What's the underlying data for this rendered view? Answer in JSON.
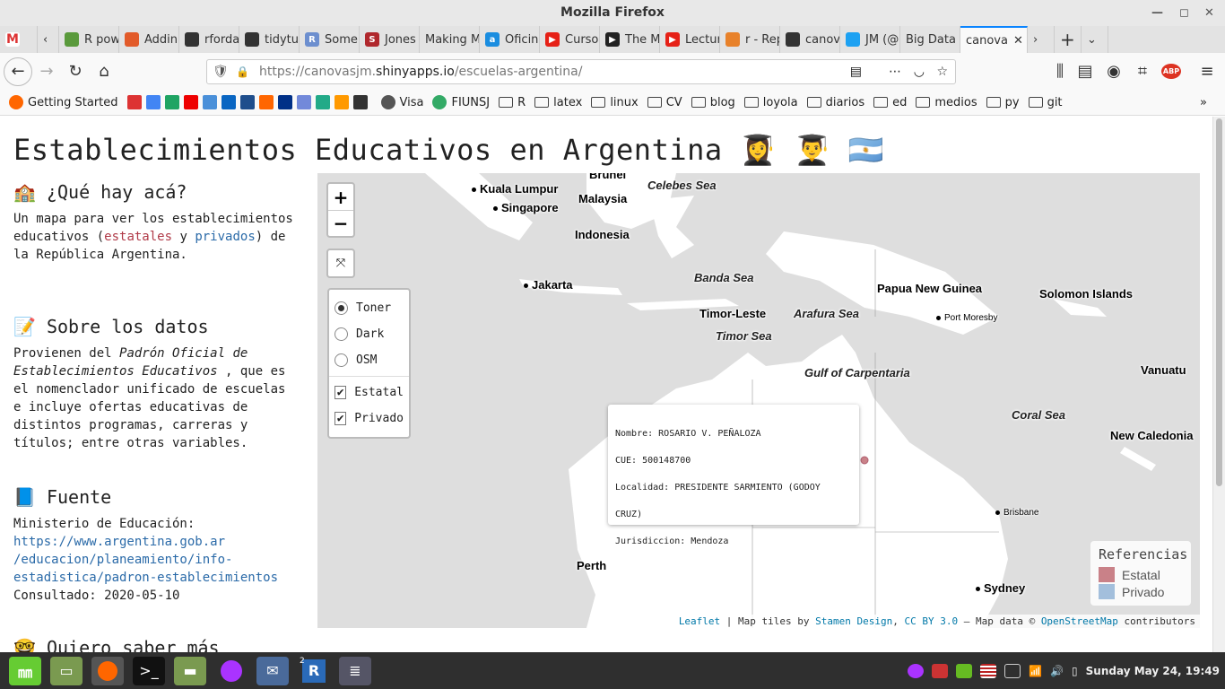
{
  "window": {
    "title": "Mozilla Firefox"
  },
  "tabs": [
    {
      "label": "",
      "color": "#d93025",
      "icon": "M"
    },
    {
      "label": "R pow",
      "color": "#5a9a3c",
      "icon": ""
    },
    {
      "label": "Addin",
      "color": "#e25b2a",
      "icon": ""
    },
    {
      "label": "rforda",
      "color": "#333333",
      "icon": ""
    },
    {
      "label": "tidytu",
      "color": "#333333",
      "icon": ""
    },
    {
      "label": "Some",
      "color": "#6d8fcf",
      "icon": "R"
    },
    {
      "label": "Jones",
      "color": "#b0282d",
      "icon": "S"
    },
    {
      "label": "Making M",
      "color": "",
      "icon": ""
    },
    {
      "label": "Oficin",
      "color": "#1a8de0",
      "icon": "a"
    },
    {
      "label": "Curso",
      "color": "#e62117",
      "icon": "▶"
    },
    {
      "label": "The M",
      "color": "#222222",
      "icon": "▶"
    },
    {
      "label": "Lectur",
      "color": "#e62117",
      "icon": "▶"
    },
    {
      "label": "r - Rep",
      "color": "#e8822b",
      "icon": ""
    },
    {
      "label": "canov",
      "color": "#333333",
      "icon": ""
    },
    {
      "label": "JM (@",
      "color": "#1da1f2",
      "icon": ""
    },
    {
      "label": "Big Data i",
      "color": "",
      "icon": ""
    },
    {
      "label": "canova",
      "color": "",
      "icon": "",
      "active": true
    }
  ],
  "url": {
    "prefix": "https://canovasjm.",
    "host": "shinyapps.io",
    "path": "/escuelas-argentina/"
  },
  "bookmarks": [
    {
      "label": "Getting Started",
      "type": "firefox"
    },
    {
      "label": "",
      "type": "icons"
    },
    {
      "label": "Visa",
      "type": "globe"
    },
    {
      "label": "FIUNSJ",
      "type": "icon"
    },
    {
      "label": "R",
      "type": "folder"
    },
    {
      "label": "latex",
      "type": "folder"
    },
    {
      "label": "linux",
      "type": "folder"
    },
    {
      "label": "CV",
      "type": "folder"
    },
    {
      "label": "blog",
      "type": "folder"
    },
    {
      "label": "loyola",
      "type": "folder"
    },
    {
      "label": "diarios",
      "type": "folder"
    },
    {
      "label": "ed",
      "type": "folder"
    },
    {
      "label": "medios",
      "type": "folder"
    },
    {
      "label": "py",
      "type": "folder"
    },
    {
      "label": "git",
      "type": "folder"
    }
  ],
  "page": {
    "title": "Establecimientos Educativos en Argentina 👩‍🎓 👨‍🎓 🇦🇷",
    "s1": {
      "heading": "🏫 ¿Qué hay acá?",
      "p1": "Un mapa para ver los establecimientos educativos (",
      "estatales": "estatales",
      "y": " y ",
      "privados": "privados",
      "p2": ") de la República Argentina."
    },
    "s2": {
      "heading": "📝 Sobre los datos",
      "p1": "Provienen del ",
      "em": "Padrón Oficial de Establecimientos Educativos",
      "p2": " , que es el nomenclador unificado de escuelas e incluye ofertas educativas de distintos programas, carreras y títulos; entre otras variables."
    },
    "s3": {
      "heading": "📘 Fuente",
      "p1": "Ministerio de Educación:",
      "link": "https://www.argentina.gob.ar/educacion/planeamiento/info-estadistica/padron-establecimientos",
      "link_display": "https://www.argentina.gob.ar\n/educacion/planeamiento/info-\nestadistica/padron-establecimientos",
      "consulted": "Consultado: 2020-05-10"
    },
    "s4": {
      "heading": "🤓 Quiero saber más"
    }
  },
  "map": {
    "zoom_in": "+",
    "zoom_out": "−",
    "fit": "⤧",
    "layers": [
      {
        "label": "Toner",
        "checked": true
      },
      {
        "label": "Dark",
        "checked": false
      },
      {
        "label": "OSM",
        "checked": false
      }
    ],
    "overlays": [
      {
        "label": "Estatal",
        "checked": true
      },
      {
        "label": "Privado",
        "checked": true
      }
    ],
    "labels": {
      "brunei": "Brunei",
      "kl": "Kuala Lumpur",
      "singapore": "Singapore",
      "malaysia": "Malaysia",
      "celebes": "Celebes Sea",
      "indonesia": "Indonesia",
      "jakarta": "Jakarta",
      "banda": "Banda Sea",
      "png": "Papua New Guinea",
      "solomon": "Solomon Islands",
      "portmoresby": "Port Moresby",
      "timorleste": "Timor-Leste",
      "arafura": "Arafura Sea",
      "timorsea": "Timor Sea",
      "carpentaria": "Gulf of Carpentaria",
      "vanuatu": "Vanuatu",
      "coral": "Coral Sea",
      "newcaledonia": "New Caledonia",
      "brisbane": "Brisbane",
      "perth": "Perth",
      "sydney": "Sydney"
    },
    "popup": {
      "nombre": "Nombre: ROSARIO V. PEÑALOZA",
      "cue": "CUE: 500148700",
      "localidad": "Localidad: PRESIDENTE SARMIENTO (GODOY CRUZ)",
      "jurisdiccion": "Jurisdiccion: Mendoza"
    },
    "legend": {
      "title": "Referencias",
      "items": [
        {
          "label": "Estatal",
          "color": "#c98188"
        },
        {
          "label": "Privado",
          "color": "#a3bfdc"
        }
      ]
    },
    "attribution": {
      "leaflet": "Leaflet",
      "sep1": " | Map tiles by ",
      "stamen": "Stamen Design",
      "sep2": ", ",
      "license": "CC BY 3.0",
      "sep3": " — Map data © ",
      "osm": "OpenStreetMap",
      "sep4": " contributors"
    }
  },
  "taskbar": {
    "clock": "Sunday May 24, 19:49",
    "badge": "2"
  }
}
